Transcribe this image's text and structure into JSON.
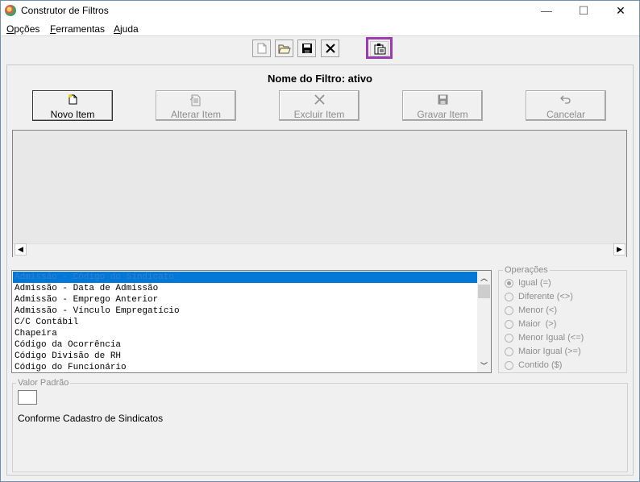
{
  "window": {
    "title": "Construtor de Filtros",
    "controls": {
      "minimize": "—",
      "maximize": "☐",
      "close": "✕"
    }
  },
  "menu": [
    {
      "label": "Opções",
      "mnemonic": "O",
      "rest": "pções"
    },
    {
      "label": "Ferramentas",
      "mnemonic": "F",
      "rest": "erramentas"
    },
    {
      "label": "Ajuda",
      "mnemonic": "A",
      "rest": "juda"
    }
  ],
  "toolbar": {
    "icons": [
      "new-file-icon",
      "open-folder-icon",
      "save-disk-icon",
      "delete-x-icon",
      "clipboard-icon"
    ]
  },
  "filter": {
    "name_label": "Nome do Filtro: ativo"
  },
  "actions": [
    {
      "label": "Novo Item",
      "enabled": true
    },
    {
      "label": "Alterar Item",
      "enabled": false
    },
    {
      "label": "Excluir Item",
      "enabled": false
    },
    {
      "label": "Gravar Item",
      "enabled": false
    },
    {
      "label": "Cancelar",
      "enabled": false
    }
  ],
  "fields": [
    "Admissão - Código do Sindicato",
    "Admissão - Data de Admissão",
    "Admissão - Emprego Anterior",
    "Admissão - Vínculo Empregatício",
    "C/C Contábil",
    "Chapeira",
    "Código da Ocorrência",
    "Código Divisão de RH",
    "Código do Funcionário"
  ],
  "selected_field_index": 0,
  "operations": {
    "title": "Operações",
    "options": [
      "Igual (=)",
      "Diferente (<>)",
      "Menor (<)",
      "Maior  (>)",
      "Menor Igual (<=)",
      "Maior Igual (>=)",
      "Contido ($)"
    ],
    "selected_index": 0
  },
  "default_value": {
    "title": "Valor Padrão",
    "value": "",
    "description": "Conforme Cadastro de Sindicatos"
  },
  "colors": {
    "selection": "#0078d7",
    "highlight_border": "#9b3bb0",
    "disabled_text": "#8d8d8d"
  }
}
